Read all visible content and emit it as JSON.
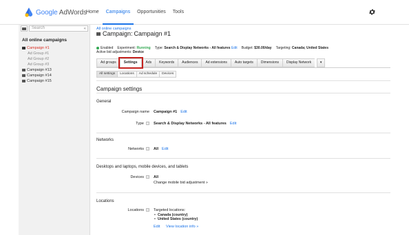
{
  "app": {
    "logo_google": "Google",
    "logo_product": " AdWords",
    "nav": [
      "Home",
      "Campaigns",
      "Opportunities",
      "Tools"
    ],
    "nav_active_index": 1,
    "accent": "#1a73e8",
    "status_green": "#34a853",
    "selected_red": "#d93025"
  },
  "sidebar": {
    "search_placeholder": "Search",
    "title": "All online campaigns",
    "items": [
      {
        "label": "Campaign #1",
        "type": "campaign",
        "selected": true
      },
      {
        "label": "Ad Group #1",
        "type": "adgroup"
      },
      {
        "label": "Ad Group #2",
        "type": "adgroup"
      },
      {
        "label": "Ad Group #3",
        "type": "adgroup"
      },
      {
        "label": "Campaign #13",
        "type": "campaign"
      },
      {
        "label": "Campaign #14",
        "type": "campaign"
      },
      {
        "label": "Campaign #15",
        "type": "campaign"
      }
    ]
  },
  "header": {
    "breadcrumb": "All online campaigns",
    "title_prefix": "Campaign: ",
    "title_name": "Campaign #1",
    "status_enabled": "Enabled",
    "experiment_label": "Experiment:",
    "experiment_value": "Running",
    "type_label": "Type:",
    "type_value": "Search & Display Networks - All features",
    "type_edit": "Edit",
    "budget_label": "Budget:",
    "budget_value": "$30.00/day",
    "targeting_label": "Targeting:",
    "targeting_value": "Canada; United States",
    "bid_adj_label": "Active bid adjustments:",
    "bid_adj_value": "Device"
  },
  "tabs": {
    "items": [
      "Ad groups",
      "Settings",
      "Ads",
      "Keywords",
      "Audiences",
      "Ad extensions",
      "Auto targets",
      "Dimensions",
      "Display Network"
    ],
    "active_index": 1,
    "more_label": "▾"
  },
  "subtabs": {
    "items": [
      "All settings",
      "Locations",
      "Ad schedule",
      "Devices"
    ],
    "active_index": 0
  },
  "settings": {
    "heading": "Campaign settings",
    "general_title": "General",
    "campaign_name_label": "Campaign name",
    "campaign_name_value": "Campaign #1",
    "campaign_name_edit": "Edit",
    "type_label": "Type",
    "type_value": "Search & Display Networks - All features",
    "type_edit": "Edit",
    "networks_title": "Networks",
    "networks_label": "Networks",
    "networks_value": "All",
    "networks_edit": "Edit",
    "devices_title": "Desktops and laptops, mobile devices, and tablets",
    "devices_label": "Devices",
    "devices_value": "All",
    "devices_link": "Change mobile bid adjustment »",
    "locations_title": "Locations",
    "locations_label": "Locations",
    "targeted_label": "Targeted locations:",
    "targeted": [
      "Canada (country)",
      "United States (country)"
    ],
    "locations_edit": "Edit",
    "locations_view": "View location info »",
    "help_glyph": "?"
  }
}
